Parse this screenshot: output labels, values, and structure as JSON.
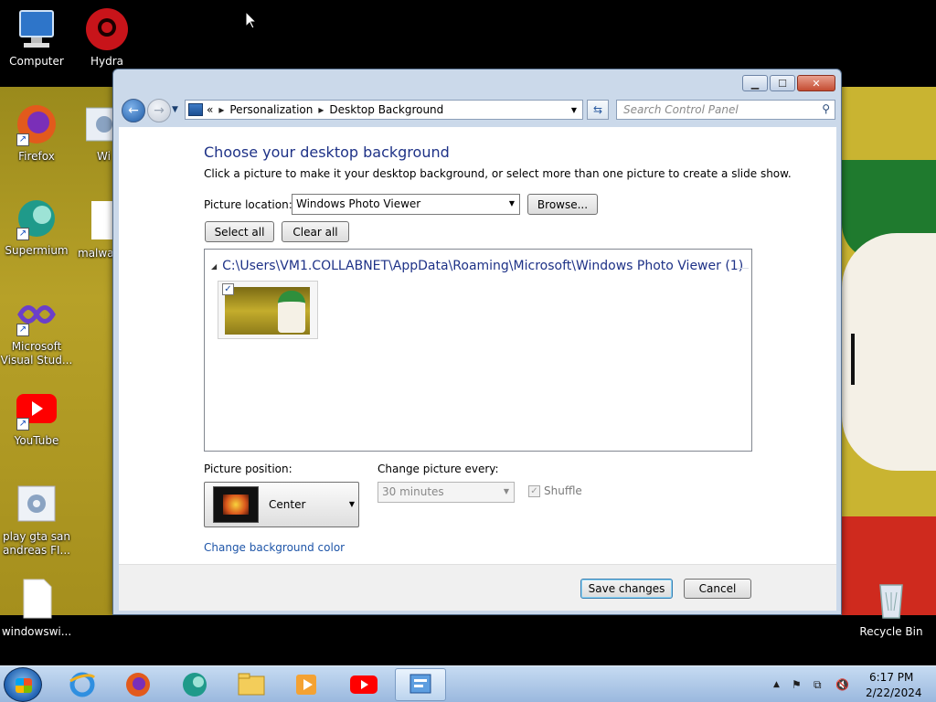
{
  "desktop": {
    "icons": [
      {
        "label": "Computer",
        "icon": "computer-icon"
      },
      {
        "label": "Hydra",
        "icon": "hydra-icon"
      },
      {
        "label": "Firefox",
        "icon": "firefox-icon"
      },
      {
        "label": "Wi",
        "icon": "settings-shortcut-icon"
      },
      {
        "label": "Supermium",
        "icon": "supermium-icon"
      },
      {
        "label": "malwa",
        "icon": "file-icon"
      },
      {
        "label": "Microsoft Visual Stud...",
        "icon": "visual-studio-icon"
      },
      {
        "label": "YouTube",
        "icon": "youtube-icon"
      },
      {
        "label": "play gta san andreas FI...",
        "icon": "settings-file-icon"
      },
      {
        "label": "windowswi...",
        "icon": "file-icon"
      },
      {
        "label": "Recycle Bin",
        "icon": "recycle-bin-icon"
      }
    ]
  },
  "window": {
    "breadcrumb": {
      "root": "«",
      "items": [
        "Personalization",
        "Desktop Background"
      ]
    },
    "search_placeholder": "Search Control Panel",
    "title": "Choose your desktop background",
    "description": "Click a picture to make it your desktop background, or select more than one picture to create a slide show.",
    "picture_location_label": "Picture location:",
    "picture_location_value": "Windows Photo Viewer",
    "browse_label": "Browse...",
    "select_all_label": "Select all",
    "clear_all_label": "Clear all",
    "group_header": "C:\\Users\\VM1.COLLABNET\\AppData\\Roaming\\Microsoft\\Windows Photo Viewer (1)",
    "thumbnail_checked": true,
    "picture_position_label": "Picture position:",
    "picture_position_value": "Center",
    "change_every_label": "Change picture every:",
    "change_every_value": "30 minutes",
    "shuffle_label": "Shuffle",
    "shuffle_checked": true,
    "bg_color_link": "Change background color",
    "save_label": "Save changes",
    "cancel_label": "Cancel"
  },
  "taskbar": {
    "pinned": [
      "internet-explorer-icon",
      "firefox-icon",
      "supermium-icon",
      "file-explorer-icon",
      "media-player-icon",
      "youtube-icon",
      "control-panel-icon"
    ],
    "time": "6:17 PM",
    "date": "2/22/2024"
  }
}
